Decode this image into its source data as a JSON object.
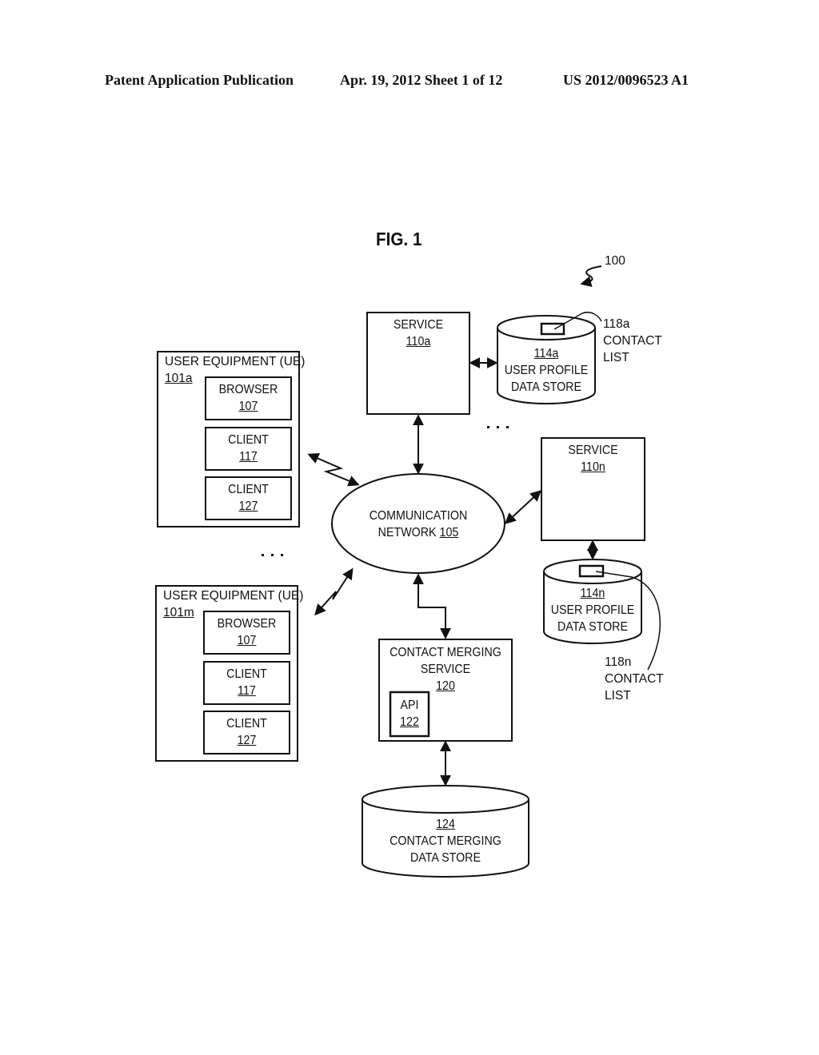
{
  "header": {
    "publication": "Patent Application Publication",
    "date_sheet": "Apr. 19, 2012  Sheet 1 of 12",
    "patent_number": "US 2012/0096523 A1"
  },
  "figure": {
    "title": "FIG. 1",
    "ref": "100"
  },
  "ue_a": {
    "title": "USER EQUIPMENT (UE)",
    "ref": "101a",
    "components": [
      {
        "name": "BROWSER",
        "ref": "107"
      },
      {
        "name": "CLIENT",
        "ref": "117"
      },
      {
        "name": "CLIENT",
        "ref": "127"
      }
    ]
  },
  "ue_m": {
    "title": "USER EQUIPMENT (UE)",
    "ref": "101m",
    "components": [
      {
        "name": "BROWSER",
        "ref": "107"
      },
      {
        "name": "CLIENT",
        "ref": "117"
      },
      {
        "name": "CLIENT",
        "ref": "127"
      }
    ]
  },
  "ellipsis": "· · ·",
  "service_a": {
    "name": "SERVICE",
    "ref": "110a"
  },
  "service_n": {
    "name": "SERVICE",
    "ref": "110n"
  },
  "store_a": {
    "ref": "114a",
    "line1": "USER PROFILE",
    "line2": "DATA STORE"
  },
  "store_n": {
    "ref": "114n",
    "line1": "USER PROFILE",
    "line2": "DATA STORE"
  },
  "contact_list_a": {
    "ref": "118a",
    "line1": "CONTACT",
    "line2": "LIST"
  },
  "contact_list_n": {
    "ref": "118n",
    "line1": "CONTACT",
    "line2": "LIST"
  },
  "network": {
    "line1": "COMMUNICATION",
    "line2_prefix": "NETWORK ",
    "ref": "105"
  },
  "merging_service": {
    "line1": "CONTACT MERGING",
    "line2": "SERVICE",
    "ref": "120"
  },
  "api": {
    "name": "API",
    "ref": "122"
  },
  "merging_store": {
    "ref": "124",
    "line1": "CONTACT  MERGING",
    "line2": "DATA STORE"
  }
}
